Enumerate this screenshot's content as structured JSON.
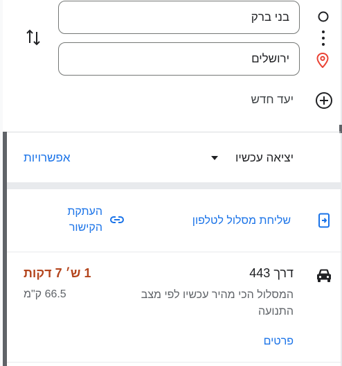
{
  "directions": {
    "origin": "בני ברק",
    "destination": "ירושלים",
    "add_destination": "יעד חדש"
  },
  "departure": {
    "label": "יציאה עכשיו",
    "options": "אפשרויות"
  },
  "actions": {
    "send_to_phone": "שליחת מסלול לטלפון",
    "copy_link": "העתקת הקישור"
  },
  "route": {
    "name": "דרך 443",
    "duration": "1 ש׳ 7 דקות",
    "description": "המסלול הכי מהיר עכשיו לפי מצב התנועה",
    "distance": "66.5 ק\"מ",
    "details": "פרטים"
  },
  "icons": {
    "swap": "swap-vertical-icon",
    "origin": "circle-outline-icon",
    "more": "vertical-dots-icon",
    "destination": "location-pin-icon",
    "add": "add-circle-icon",
    "send": "send-to-device-icon",
    "link": "link-icon",
    "car": "car-icon",
    "caret": "caret-down-icon"
  },
  "colors": {
    "accent": "#1a73e8",
    "duration": "#b3441c",
    "pin": "#ea4335"
  }
}
